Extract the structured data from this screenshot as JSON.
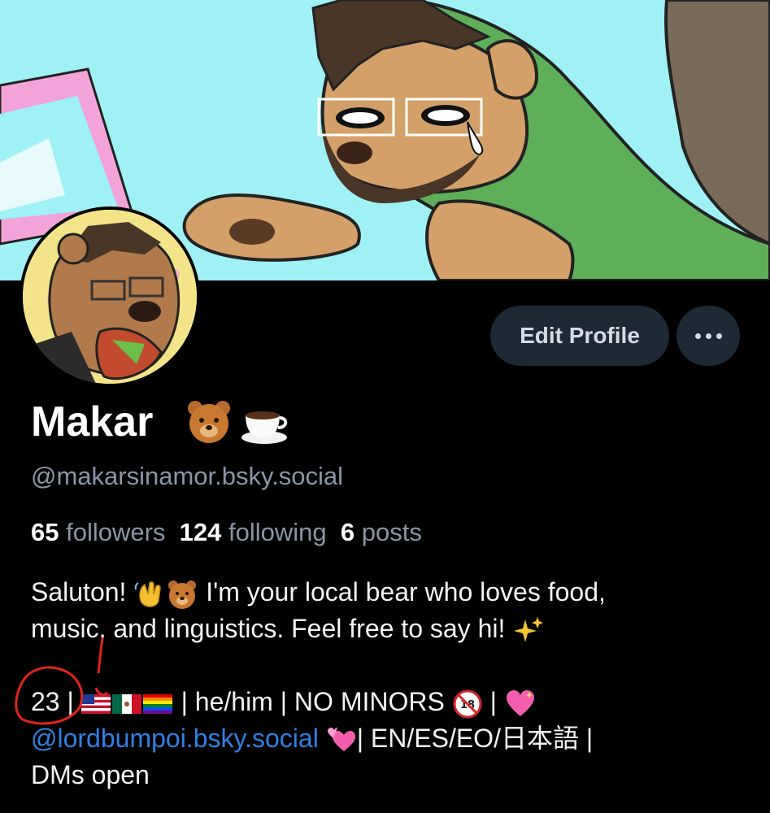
{
  "profile": {
    "display_name": "Makar",
    "name_emojis": [
      "bear-emoji",
      "coffee-emoji"
    ],
    "handle": "@makarsinamor.bsky.social",
    "stats": {
      "followers_count": "65",
      "followers_label": "followers",
      "following_count": "124",
      "following_label": "following",
      "posts_count": "6",
      "posts_label": "posts"
    },
    "bio": {
      "line1_a": "Saluton! ",
      "line1_b": " I'm your local bear who loves food,",
      "line2": "music, and linguistics. Feel free to say hi! ",
      "age": "23",
      "sep": "|",
      "pronouns": "he/him",
      "no_minors": "NO MINORS ",
      "mention": "@lordbumpoi.bsky.social",
      "languages": "EN/ES/EO/日本語",
      "dms": "DMs open"
    }
  },
  "actions": {
    "edit_profile": "Edit Profile"
  },
  "colors": {
    "background": "#000000",
    "button_bg": "#1e2936",
    "link": "#2f7fe6",
    "muted": "#8a96a6",
    "annotation": "#e0241c"
  }
}
